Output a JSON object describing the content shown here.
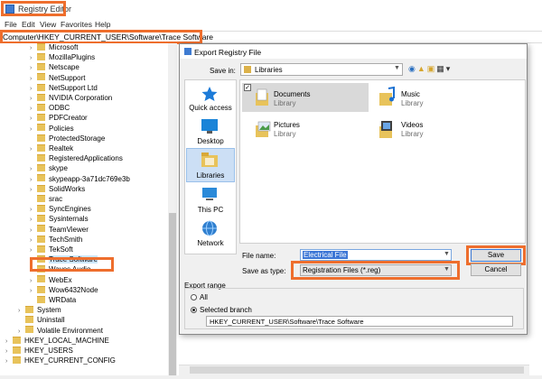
{
  "window": {
    "title": "Registry Editor",
    "menus": [
      "File",
      "Edit",
      "View",
      "Favorites",
      "Help"
    ],
    "address": "Computer\\HKEY_CURRENT_USER\\Software\\Trace Software"
  },
  "tree": {
    "items": [
      {
        "label": "Microsoft",
        "indent": 2,
        "arrow": true
      },
      {
        "label": "MozillaPlugins",
        "indent": 2,
        "arrow": true
      },
      {
        "label": "Netscape",
        "indent": 2,
        "arrow": true
      },
      {
        "label": "NetSupport",
        "indent": 2,
        "arrow": true
      },
      {
        "label": "NetSupport Ltd",
        "indent": 2,
        "arrow": true
      },
      {
        "label": "NVIDIA Corporation",
        "indent": 2,
        "arrow": true
      },
      {
        "label": "ODBC",
        "indent": 2,
        "arrow": true
      },
      {
        "label": "PDFCreator",
        "indent": 2,
        "arrow": true
      },
      {
        "label": "Policies",
        "indent": 2,
        "arrow": true
      },
      {
        "label": "ProtectedStorage",
        "indent": 2,
        "arrow": false
      },
      {
        "label": "Realtek",
        "indent": 2,
        "arrow": true
      },
      {
        "label": "RegisteredApplications",
        "indent": 2,
        "arrow": false
      },
      {
        "label": "skype",
        "indent": 2,
        "arrow": true
      },
      {
        "label": "skypeapp-3a71dc769e3b",
        "indent": 2,
        "arrow": true
      },
      {
        "label": "SolidWorks",
        "indent": 2,
        "arrow": true
      },
      {
        "label": "srac",
        "indent": 2,
        "arrow": false
      },
      {
        "label": "SyncEngines",
        "indent": 2,
        "arrow": true
      },
      {
        "label": "Sysinternals",
        "indent": 2,
        "arrow": true
      },
      {
        "label": "TeamViewer",
        "indent": 2,
        "arrow": true
      },
      {
        "label": "TechSmith",
        "indent": 2,
        "arrow": true
      },
      {
        "label": "TekSoft",
        "indent": 2,
        "arrow": true
      },
      {
        "label": "Trace Software",
        "indent": 2,
        "arrow": false,
        "selected": true
      },
      {
        "label": "Waves Audio",
        "indent": 2,
        "arrow": true
      },
      {
        "label": "WebEx",
        "indent": 2,
        "arrow": true
      },
      {
        "label": "Wow6432Node",
        "indent": 2,
        "arrow": true
      },
      {
        "label": "WRData",
        "indent": 2,
        "arrow": false
      },
      {
        "label": "System",
        "indent": 1,
        "arrow": true
      },
      {
        "label": "Uninstall",
        "indent": 1,
        "arrow": false
      },
      {
        "label": "Volatile Environment",
        "indent": 1,
        "arrow": true
      },
      {
        "label": "HKEY_LOCAL_MACHINE",
        "indent": 0,
        "arrow": true
      },
      {
        "label": "HKEY_USERS",
        "indent": 0,
        "arrow": true
      },
      {
        "label": "HKEY_CURRENT_CONFIG",
        "indent": 0,
        "arrow": true
      }
    ]
  },
  "dialog": {
    "title": "Export Registry File",
    "save_in_label": "Save in:",
    "save_in_value": "Libraries",
    "places": [
      {
        "label": "Quick access",
        "icon": "star-icon"
      },
      {
        "label": "Desktop",
        "icon": "desktop-icon"
      },
      {
        "label": "Libraries",
        "icon": "libraries-icon",
        "selected": true
      },
      {
        "label": "This PC",
        "icon": "pc-icon"
      },
      {
        "label": "Network",
        "icon": "network-icon"
      }
    ],
    "libraries": [
      {
        "name": "Documents",
        "sub": "Library",
        "icon": "documents-icon"
      },
      {
        "name": "Music",
        "sub": "Library",
        "icon": "music-icon"
      },
      {
        "name": "Pictures",
        "sub": "Library",
        "icon": "pictures-icon"
      },
      {
        "name": "Videos",
        "sub": "Library",
        "icon": "videos-icon"
      }
    ],
    "file_name_label": "File name:",
    "file_name_value": "Electrical File",
    "save_type_label": "Save as type:",
    "save_type_value": "Registration Files (*.reg)",
    "save_label": "Save",
    "cancel_label": "Cancel",
    "export_range_label": "Export range",
    "radio_all_label": "All",
    "radio_branch_label": "Selected branch",
    "branch_value": "HKEY_CURRENT_USER\\Software\\Trace Software"
  },
  "colors": {
    "highlight": "#ee6e2d",
    "accent": "#3b76d6",
    "folder": "#e8c35b"
  }
}
